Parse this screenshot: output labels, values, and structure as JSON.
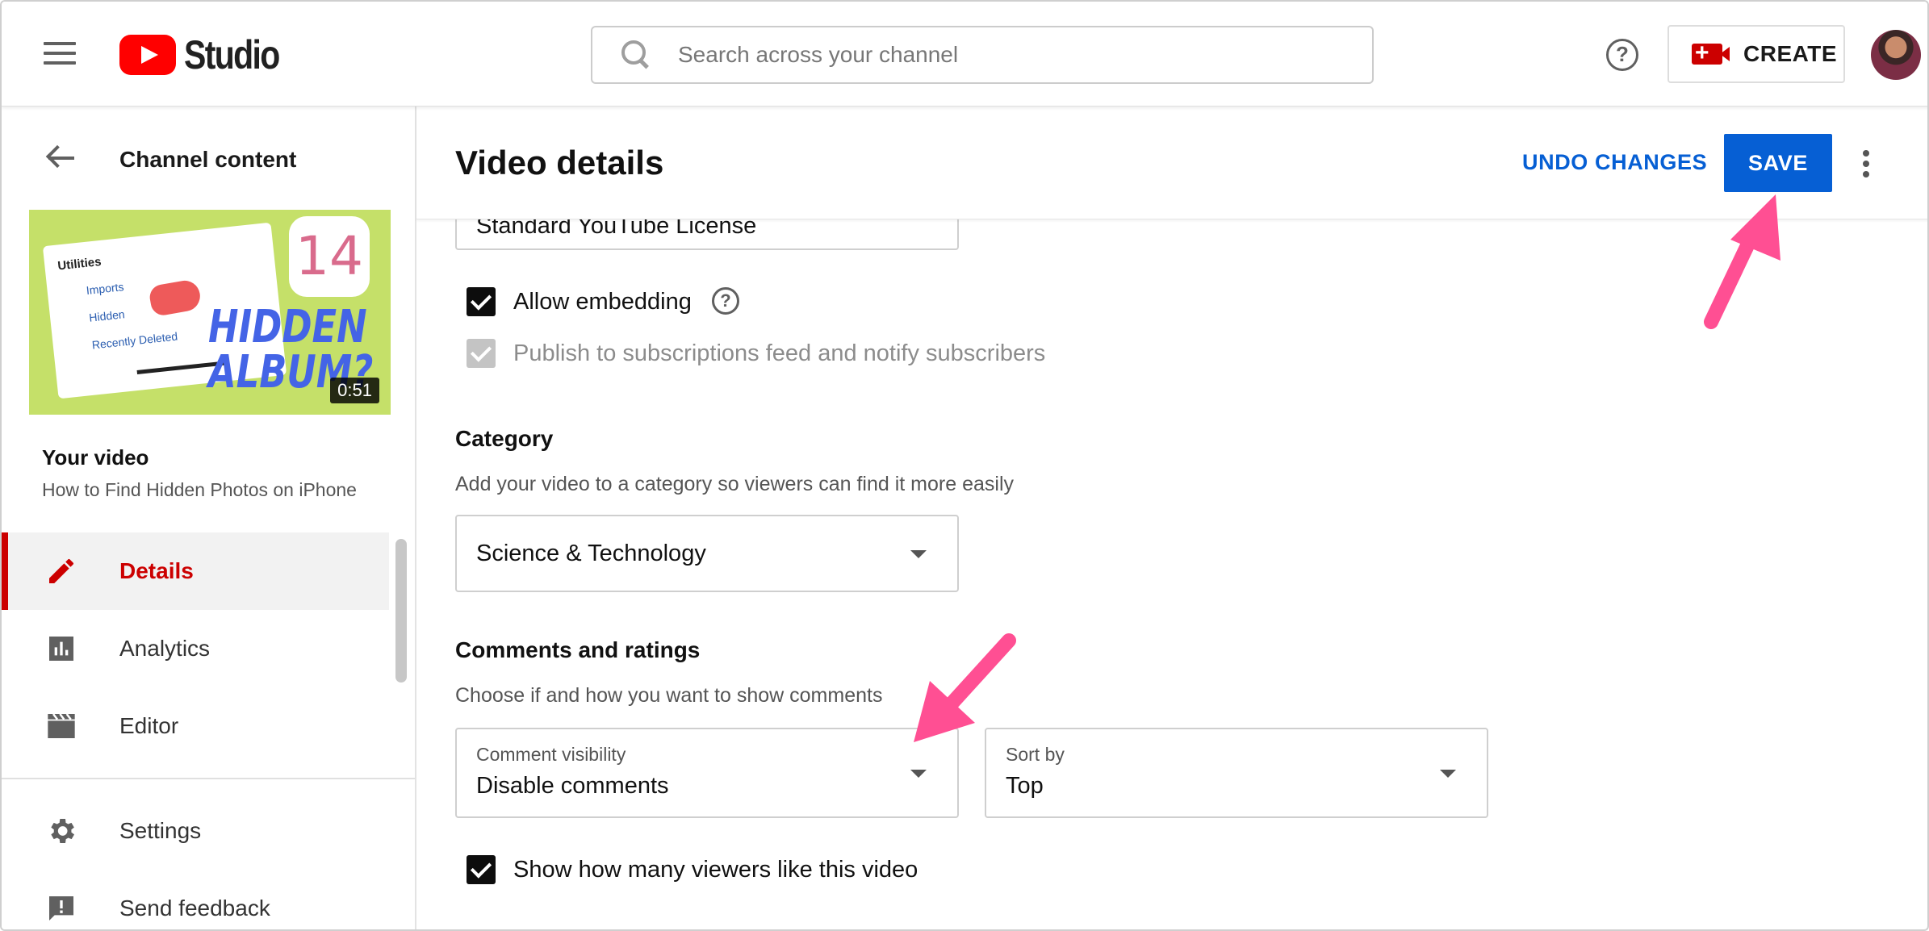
{
  "header": {
    "logo_text": "Studio",
    "search_placeholder": "Search across your channel",
    "help_icon_glyph": "?",
    "create_label": "CREATE"
  },
  "sidebar": {
    "back_label": "Channel content",
    "thumbnail": {
      "duration": "0:51",
      "headline": "HIDDEN ALBUM?",
      "ios_badge": "14",
      "card_heading": "Utilities",
      "card_rows": [
        "Imports",
        "Hidden",
        "Recently Deleted"
      ]
    },
    "your_video_label": "Your video",
    "video_title": "How to Find Hidden Photos on iPhone",
    "nav": [
      {
        "label": "Details",
        "icon": "pencil-icon",
        "active": true
      },
      {
        "label": "Analytics",
        "icon": "analytics-icon",
        "active": false
      },
      {
        "label": "Editor",
        "icon": "clapperboard-icon",
        "active": false
      },
      {
        "label": "Settings",
        "icon": "gear-icon",
        "active": false
      },
      {
        "label": "Send feedback",
        "icon": "feedback-icon",
        "active": false
      }
    ]
  },
  "main": {
    "title": "Video details",
    "undo_label": "UNDO CHANGES",
    "save_label": "SAVE",
    "license_value": "Standard YouTube License",
    "allow_embedding": {
      "label": "Allow embedding",
      "checked": true
    },
    "publish_to_subs": {
      "label": "Publish to subscriptions feed and notify subscribers",
      "checked": true,
      "disabled": true
    },
    "category": {
      "title": "Category",
      "description": "Add your video to a category so viewers can find it more easily",
      "value": "Science & Technology"
    },
    "comments": {
      "title": "Comments and ratings",
      "description": "Choose if and how you want to show comments",
      "visibility_caption": "Comment visibility",
      "visibility_value": "Disable comments",
      "sort_caption": "Sort by",
      "sort_value": "Top"
    },
    "show_likes": {
      "label": "Show how many viewers like this video",
      "checked": true
    }
  },
  "colors": {
    "accent_blue": "#065fd4",
    "brand_red": "#ff0000",
    "active_red": "#cc0000",
    "annotation_pink": "#ff4f93"
  }
}
